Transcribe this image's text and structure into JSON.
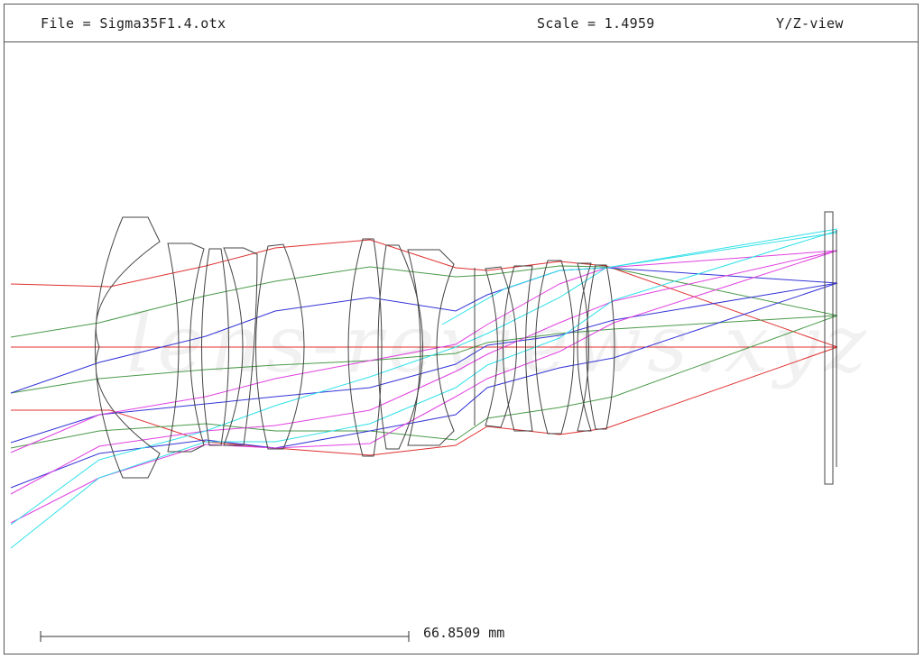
{
  "header": {
    "file_text": "File = Sigma35F1.4.otx",
    "scale_text": "Scale = 1.4959",
    "view_text": "Y/Z-view"
  },
  "scale_bar": {
    "label": "66.8509 mm"
  },
  "watermark": {
    "text": "lens-reviews.xyz"
  },
  "colors": {
    "frame": "#555555",
    "lens_outline": "#444444",
    "ray_red": "#e03030",
    "ray_green": "#4a9a4a",
    "ray_blue": "#3434d8",
    "ray_magenta": "#e040e0",
    "ray_cyan": "#30e0e8"
  }
}
